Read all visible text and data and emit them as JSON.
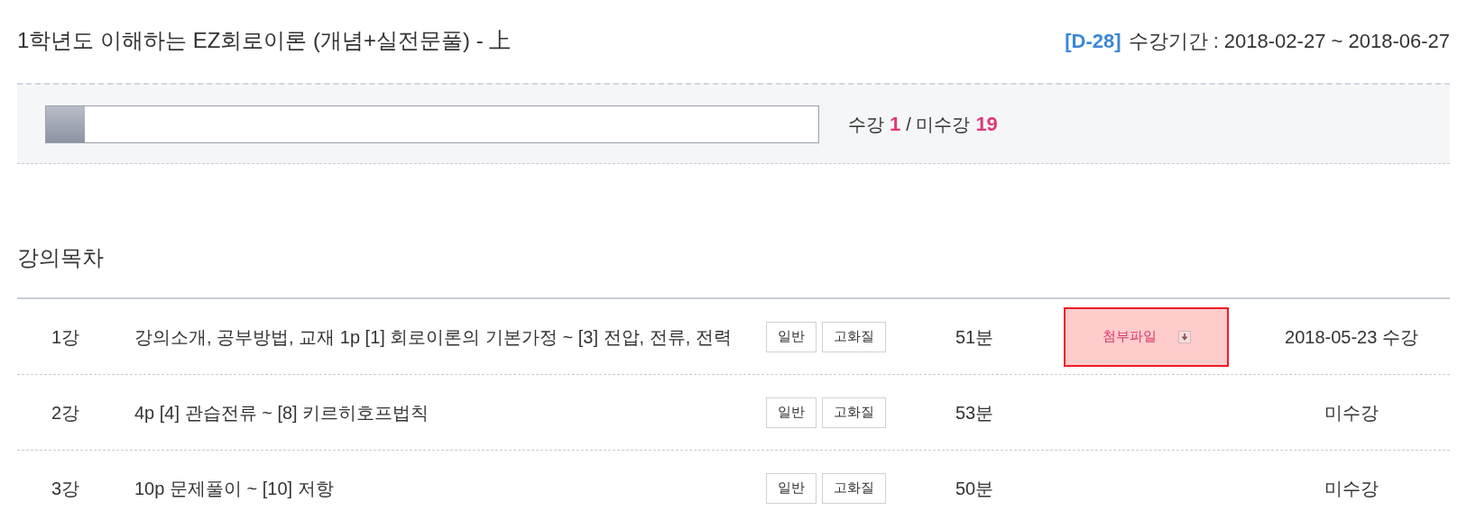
{
  "course": {
    "title": "1학년도 이해하는 EZ회로이론 (개념+실전문풀) - 上",
    "d_day": "[D-28]",
    "period": "수강기간 : 2018-02-27 ~ 2018-06-27"
  },
  "progress": {
    "level": 0.05,
    "watched_label": "수강",
    "watched": "1",
    "unwatched_label": "/ 미수강",
    "unwatched": "19"
  },
  "section_title": "강의목차",
  "lectures": [
    {
      "number": "1강",
      "title": "강의소개, 공부방법, 교재 1p [1] 회로이론의 기본가정 ~ [3] 전압, 전류, 전력",
      "buttons": [
        "일반",
        "고화질"
      ],
      "duration": "51분",
      "attachment": "첨부파일",
      "status": "2018-05-23 수강"
    },
    {
      "number": "2강",
      "title": "4p [4] 관습전류 ~ [8] 키르히호프법칙",
      "buttons": [
        "일반",
        "고화질"
      ],
      "duration": "53분",
      "status": "미수강"
    },
    {
      "number": "3강",
      "title": "10p 문제풀이 ~ [10] 저항",
      "buttons": [
        "일반",
        "고화질"
      ],
      "duration": "50분",
      "status": "미수강"
    }
  ]
}
